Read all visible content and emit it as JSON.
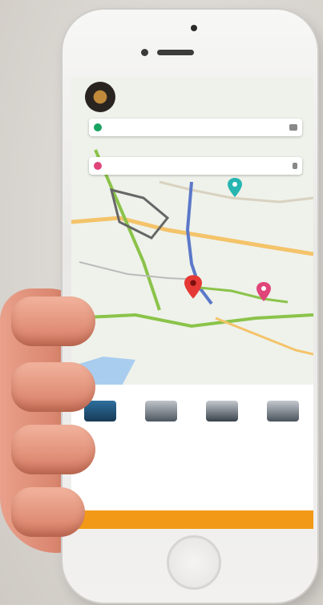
{
  "map": {
    "pickup_placeholder": "",
    "drop_placeholder": ""
  },
  "vehicles": [
    {
      "name": "",
      "meta": ""
    },
    {
      "name": "",
      "meta": ""
    },
    {
      "name": "",
      "meta": ""
    },
    {
      "name": "",
      "meta": ""
    }
  ],
  "panel": {
    "line1": "",
    "line2": "",
    "footer_left": "",
    "footer_right": "",
    "book_button": ""
  },
  "colors": {
    "accent": "#f29a17",
    "pickup_pin": "#1aa260",
    "drop_pin": "#e0457a",
    "marker_red": "#e53935"
  }
}
